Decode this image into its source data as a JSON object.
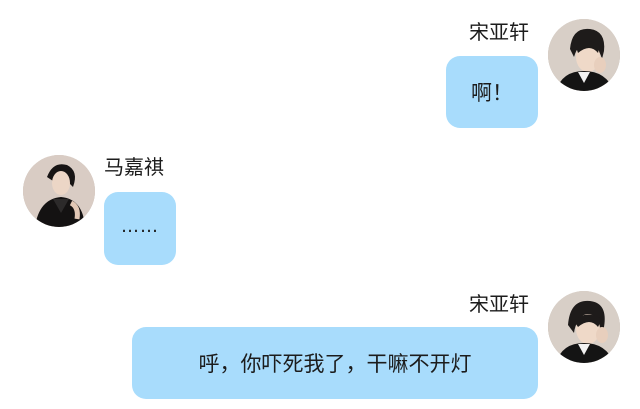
{
  "messages": [
    {
      "sender": "宋亚轩",
      "side": "right",
      "text": "啊！"
    },
    {
      "sender": "马嘉祺",
      "side": "left",
      "text": "……"
    },
    {
      "sender": "宋亚轩",
      "side": "right",
      "text": "呼，你吓死我了，干嘛不开灯"
    }
  ],
  "colors": {
    "bubble": "#a8dcfc",
    "background": "#ffffff",
    "text": "#1c1c1c"
  }
}
